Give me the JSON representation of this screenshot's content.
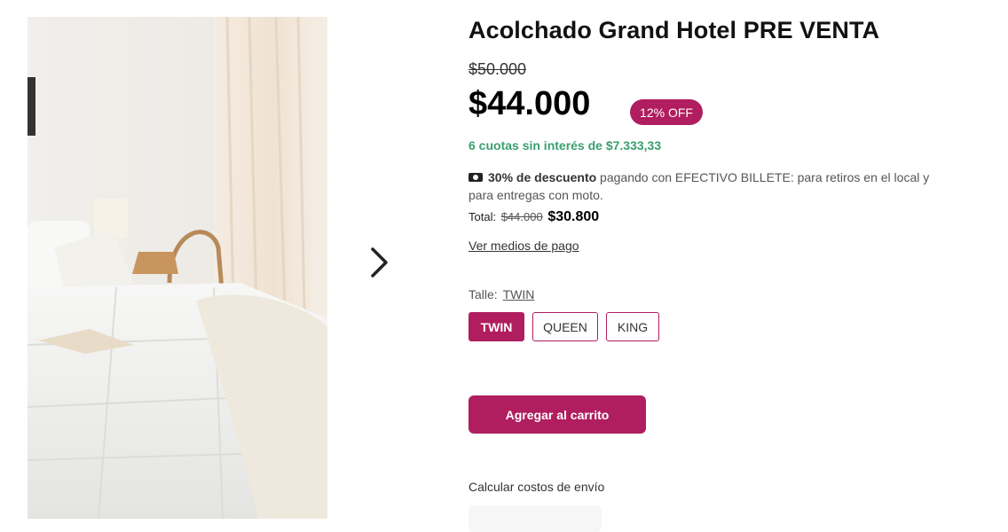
{
  "product": {
    "title": "Acolchado Grand Hotel PRE VENTA",
    "old_price": "$50.000",
    "price": "$44.000",
    "discount_badge": "12% OFF",
    "installments": "6 cuotas sin interés de $7.333,33"
  },
  "cash_promo": {
    "icon": "cash-icon",
    "highlight": "30% de descuento",
    "text": "pagando con EFECTIVO BILLETE: para retiros en el local y para entregas con moto.",
    "total_label": "Total:",
    "total_original": "$44.000",
    "total_final": "$30.800"
  },
  "payment_methods_link": "Ver medios de pago",
  "size": {
    "label": "Talle:",
    "selected": "TWIN",
    "options": [
      "TWIN",
      "QUEEN",
      "KING"
    ]
  },
  "add_to_cart": "Agregar al carrito",
  "shipping": {
    "label": "Calcular costos de envío"
  },
  "gallery": {
    "next_icon": "chevron-right-icon"
  },
  "colors": {
    "accent": "#b01e5f",
    "installments": "#3a9f70"
  }
}
